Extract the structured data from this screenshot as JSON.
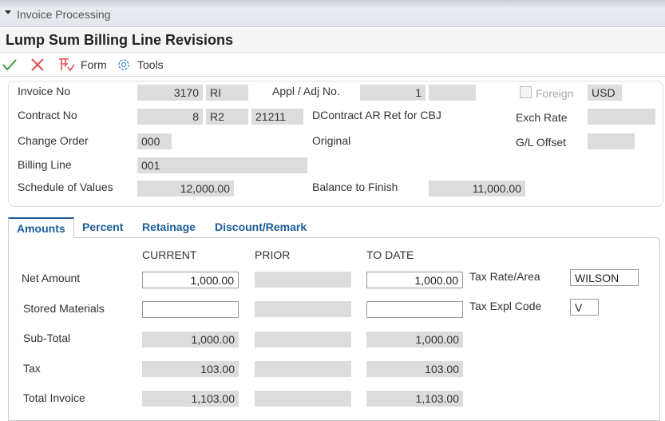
{
  "header": {
    "section": "Invoice Processing",
    "title": "Lump Sum Billing Line Revisions"
  },
  "toolbar": {
    "form": "Form",
    "tools": "Tools",
    "form_key": "F",
    "tools_key": "T"
  },
  "header_fields": {
    "invoice_no": {
      "label": "Invoice No",
      "value": "3170",
      "type": "RI"
    },
    "appl_adj": {
      "label": "Appl / Adj No.",
      "value": "1",
      "value2": ""
    },
    "foreign": {
      "label": "Foreign",
      "checked": false
    },
    "currency": "USD",
    "contract_no": {
      "label": "Contract No",
      "value": "8",
      "type": "R2",
      "company": "21211",
      "desc": "DContract AR Ret for CBJ"
    },
    "exch_rate": {
      "label": "Exch Rate",
      "value": ""
    },
    "change_order": {
      "label": "Change Order",
      "value": "000",
      "desc": "Original"
    },
    "gl_offset": {
      "label": "G/L Offset",
      "value": ""
    },
    "billing_line": {
      "label": "Billing Line",
      "value": "001"
    },
    "schedule_of_values": {
      "label": "Schedule of Values",
      "value": "12,000.00"
    },
    "balance_to_finish": {
      "label": "Balance to Finish",
      "value": "11,000.00"
    }
  },
  "tabs": [
    "Amounts",
    "Percent",
    "Retainage",
    "Discount/Remark"
  ],
  "amounts": {
    "columns": [
      "CURRENT",
      "PRIOR",
      "TO DATE"
    ],
    "rows": [
      {
        "label": "Net Amount",
        "current": "1,000.00",
        "prior": "",
        "to_date": "1,000.00"
      },
      {
        "label": "Stored Materials",
        "current": "",
        "prior": "",
        "to_date": ""
      },
      {
        "label": "Sub-Total",
        "current": "1,000.00",
        "prior": "",
        "to_date": "1,000.00"
      },
      {
        "label": "Tax",
        "current": "103.00",
        "prior": "",
        "to_date": "103.00"
      },
      {
        "label": "Total Invoice",
        "current": "1,103.00",
        "prior": "",
        "to_date": "1,103.00"
      }
    ],
    "tax_rate_area": {
      "label": "Tax Rate/Area",
      "value": "WILSON"
    },
    "tax_expl_code": {
      "label": "Tax Expl Code",
      "value": "V"
    }
  },
  "colors": {
    "accent": "#1a5c9a",
    "ok": "#3a9a3a",
    "cancel": "#e05050"
  }
}
